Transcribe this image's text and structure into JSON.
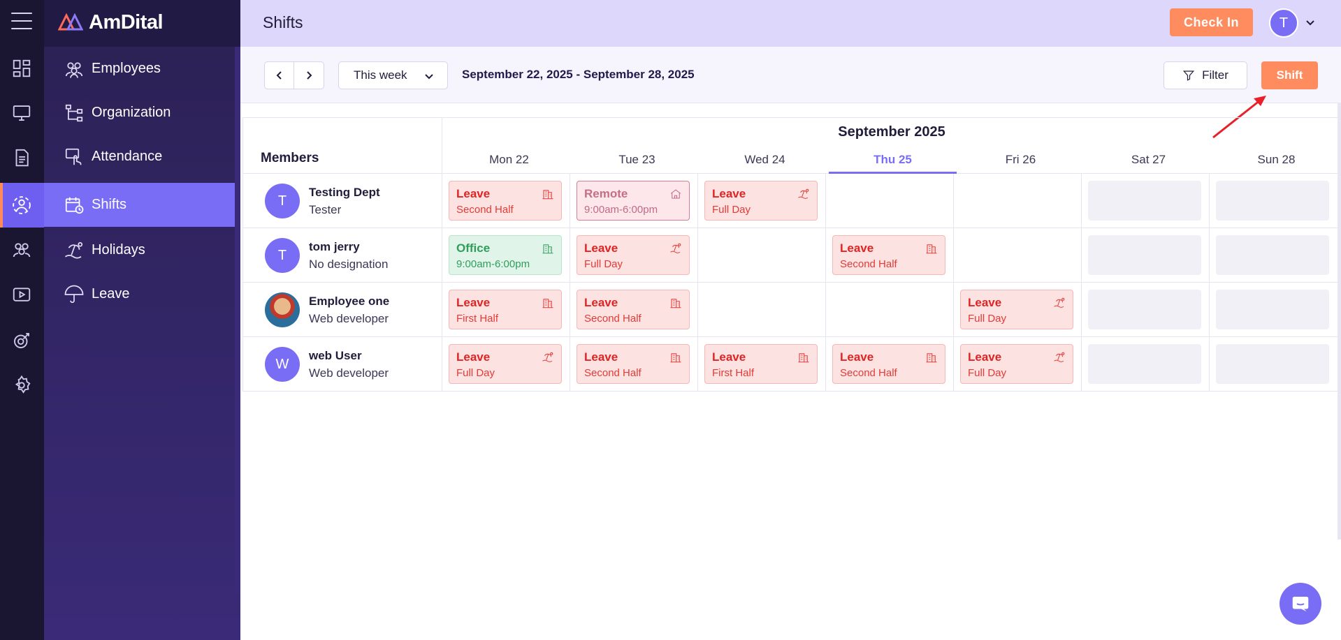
{
  "brand": {
    "name": "AmDital"
  },
  "header": {
    "title": "Shifts",
    "check_in": "Check In",
    "avatar_initial": "T"
  },
  "nav": [
    {
      "label": "Employees",
      "icon": "users-icon"
    },
    {
      "label": "Organization",
      "icon": "org-chart-icon"
    },
    {
      "label": "Attendance",
      "icon": "touch-icon"
    },
    {
      "label": "Shifts",
      "icon": "calendar-clock-icon",
      "active": true
    },
    {
      "label": "Holidays",
      "icon": "beach-icon"
    },
    {
      "label": "Leave",
      "icon": "umbrella-icon"
    }
  ],
  "toolbar": {
    "period": "This week",
    "date_range": "September 22, 2025 - September 28, 2025",
    "filter": "Filter",
    "shift": "Shift"
  },
  "calendar": {
    "members_label": "Members",
    "month": "September 2025",
    "days": [
      "Mon 22",
      "Tue 23",
      "Wed 24",
      "Thu 25",
      "Fri 26",
      "Sat 27",
      "Sun 28"
    ],
    "today_index": 3
  },
  "members": [
    {
      "name": "Testing Dept",
      "designation": "Tester",
      "initial": "T"
    },
    {
      "name": "tom jerry",
      "designation": "No designation",
      "initial": "T"
    },
    {
      "name": "Employee one",
      "designation": "Web developer",
      "initial": ""
    },
    {
      "name": "web User",
      "designation": "Web developer",
      "initial": "W"
    }
  ],
  "shifts": [
    [
      {
        "type": "leave",
        "title": "Leave",
        "sub": "Second Half",
        "icon": "building-icon"
      },
      {
        "type": "remote",
        "title": "Remote",
        "sub": "9:00am-6:00pm",
        "icon": "home-icon"
      },
      {
        "type": "leave",
        "title": "Leave",
        "sub": "Full Day",
        "icon": "beach-icon"
      },
      null,
      null,
      {
        "type": "weekend"
      },
      {
        "type": "weekend"
      }
    ],
    [
      {
        "type": "office",
        "title": "Office",
        "sub": "9:00am-6:00pm",
        "icon": "building-icon"
      },
      {
        "type": "leave",
        "title": "Leave",
        "sub": "Full Day",
        "icon": "beach-icon"
      },
      null,
      {
        "type": "leave",
        "title": "Leave",
        "sub": "Second Half",
        "icon": "building-icon"
      },
      null,
      {
        "type": "weekend"
      },
      {
        "type": "weekend"
      }
    ],
    [
      {
        "type": "leave",
        "title": "Leave",
        "sub": "First Half",
        "icon": "building-icon"
      },
      {
        "type": "leave",
        "title": "Leave",
        "sub": "Second Half",
        "icon": "building-icon"
      },
      null,
      null,
      {
        "type": "leave",
        "title": "Leave",
        "sub": "Full Day",
        "icon": "beach-icon"
      },
      {
        "type": "weekend"
      },
      {
        "type": "weekend"
      }
    ],
    [
      {
        "type": "leave",
        "title": "Leave",
        "sub": "Full Day",
        "icon": "beach-icon"
      },
      {
        "type": "leave",
        "title": "Leave",
        "sub": "Second Half",
        "icon": "building-icon"
      },
      {
        "type": "leave",
        "title": "Leave",
        "sub": "First Half",
        "icon": "building-icon"
      },
      {
        "type": "leave",
        "title": "Leave",
        "sub": "Second Half",
        "icon": "building-icon"
      },
      {
        "type": "leave",
        "title": "Leave",
        "sub": "Full Day",
        "icon": "beach-icon"
      },
      {
        "type": "weekend"
      },
      {
        "type": "weekend"
      }
    ]
  ],
  "colors": {
    "accent": "#7a6df5",
    "orange": "#ff8c5e",
    "leave": "#e02424",
    "office": "#2f9e5a"
  }
}
